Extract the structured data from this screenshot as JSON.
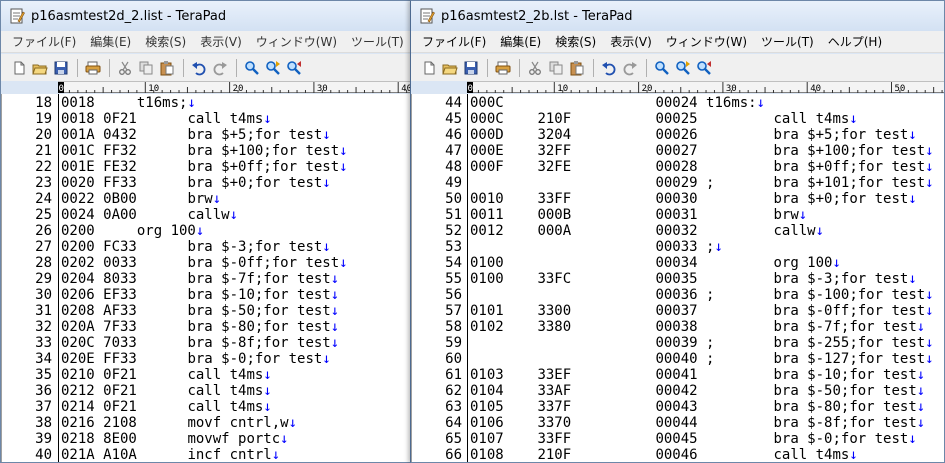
{
  "left_window": {
    "title": "p16asmtest2d_2.list - TeraPad",
    "menu": [
      "ファイル(F)",
      "編集(E)",
      "検索(S)",
      "表示(V)",
      "ウィンドウ(W)",
      "ツール(T)"
    ],
    "ruler_labels": [
      "0",
      "10",
      "20",
      "30",
      "40"
    ],
    "eol_mark": "↓",
    "lines": [
      {
        "n": "18",
        "addr": "0018",
        "code": "",
        "src": "t16ms;",
        "eol": true
      },
      {
        "n": "19",
        "addr": "0018",
        "code": "0F21",
        "src": "call t4ms",
        "eol": true
      },
      {
        "n": "20",
        "addr": "001A",
        "code": "0432",
        "src": "bra $+5;for test",
        "eol": true
      },
      {
        "n": "21",
        "addr": "001C",
        "code": "FF32",
        "src": "bra $+100;for test",
        "eol": true
      },
      {
        "n": "22",
        "addr": "001E",
        "code": "FE32",
        "src": "bra $+0ff;for test",
        "eol": true
      },
      {
        "n": "23",
        "addr": "0020",
        "code": "FF33",
        "src": "bra $+0;for test",
        "eol": true
      },
      {
        "n": "24",
        "addr": "0022",
        "code": "0B00",
        "src": "brw",
        "eol": true
      },
      {
        "n": "25",
        "addr": "0024",
        "code": "0A00",
        "src": "callw",
        "eol": true
      },
      {
        "n": "26",
        "addr": "0200",
        "code": "",
        "src": "org 100",
        "eol": true
      },
      {
        "n": "27",
        "addr": "0200",
        "code": "FC33",
        "src": "bra $-3;for test",
        "eol": true
      },
      {
        "n": "28",
        "addr": "0202",
        "code": "0033",
        "src": "bra $-0ff;for test",
        "eol": true
      },
      {
        "n": "29",
        "addr": "0204",
        "code": "8033",
        "src": "bra $-7f;for test",
        "eol": true
      },
      {
        "n": "30",
        "addr": "0206",
        "code": "EF33",
        "src": "bra $-10;for test",
        "eol": true
      },
      {
        "n": "31",
        "addr": "0208",
        "code": "AF33",
        "src": "bra $-50;for test",
        "eol": true
      },
      {
        "n": "32",
        "addr": "020A",
        "code": "7F33",
        "src": "bra $-80;for test",
        "eol": true
      },
      {
        "n": "33",
        "addr": "020C",
        "code": "7033",
        "src": "bra $-8f;for test",
        "eol": true
      },
      {
        "n": "34",
        "addr": "020E",
        "code": "FF33",
        "src": "bra $-0;for test",
        "eol": true
      },
      {
        "n": "35",
        "addr": "0210",
        "code": "0F21",
        "src": "call t4ms",
        "eol": true
      },
      {
        "n": "36",
        "addr": "0212",
        "code": "0F21",
        "src": "call t4ms",
        "eol": true
      },
      {
        "n": "37",
        "addr": "0214",
        "code": "0F21",
        "src": "call t4ms",
        "eol": true
      },
      {
        "n": "38",
        "addr": "0216",
        "code": "2108",
        "src": "movf cntrl,w",
        "eol": true
      },
      {
        "n": "39",
        "addr": "0218",
        "code": "8E00",
        "src": "movwf portc",
        "eol": true
      },
      {
        "n": "40",
        "addr": "021A",
        "code": "A10A",
        "src": "incf cntrl",
        "eol": true
      }
    ]
  },
  "right_window": {
    "title": "p16asmtest2_2b.lst - TeraPad",
    "menu": [
      "ファイル(F)",
      "編集(E)",
      "検索(S)",
      "表示(V)",
      "ウィンドウ(W)",
      "ツール(T)",
      "ヘルプ(H)"
    ],
    "ruler_labels": [
      "0",
      "10",
      "20",
      "30",
      "40",
      "50"
    ],
    "eol_mark": "↓",
    "lines": [
      {
        "n": "44",
        "addr": "000C",
        "code": "",
        "seq": "00024",
        "src": "t16ms:",
        "indent": false,
        "eol": true
      },
      {
        "n": "45",
        "addr": "000C",
        "code": "210F",
        "seq": "00025",
        "src": "call t4ms",
        "indent": true,
        "eol": true
      },
      {
        "n": "46",
        "addr": "000D",
        "code": "3204",
        "seq": "00026",
        "src": "bra $+5;for test",
        "indent": true,
        "eol": true
      },
      {
        "n": "47",
        "addr": "000E",
        "code": "32FF",
        "seq": "00027",
        "src": "bra $+100;for test",
        "indent": true,
        "eol": true
      },
      {
        "n": "48",
        "addr": "000F",
        "code": "32FE",
        "seq": "00028",
        "src": "bra $+0ff;for test",
        "indent": true,
        "eol": true
      },
      {
        "n": "49",
        "addr": "",
        "code": "",
        "seq": "00029 ;",
        "src": "bra $+101;for test",
        "indent": true,
        "eol": true
      },
      {
        "n": "50",
        "addr": "0010",
        "code": "33FF",
        "seq": "00030",
        "src": "bra $+0;for test",
        "indent": true,
        "eol": true
      },
      {
        "n": "51",
        "addr": "0011",
        "code": "000B",
        "seq": "00031",
        "src": "brw",
        "indent": true,
        "eol": true
      },
      {
        "n": "52",
        "addr": "0012",
        "code": "000A",
        "seq": "00032",
        "src": "callw",
        "indent": true,
        "eol": true
      },
      {
        "n": "53",
        "addr": "",
        "code": "",
        "seq": "00033 ;",
        "src": "",
        "indent": false,
        "eol": true
      },
      {
        "n": "54",
        "addr": "0100",
        "code": "",
        "seq": "00034",
        "src": "org 100",
        "indent": true,
        "eol": true
      },
      {
        "n": "55",
        "addr": "0100",
        "code": "33FC",
        "seq": "00035",
        "src": "bra $-3;for test",
        "indent": true,
        "eol": true
      },
      {
        "n": "56",
        "addr": "",
        "code": "",
        "seq": "00036 ;",
        "src": "bra $-100;for test",
        "indent": true,
        "eol": true
      },
      {
        "n": "57",
        "addr": "0101",
        "code": "3300",
        "seq": "00037",
        "src": "bra $-0ff;for test",
        "indent": true,
        "eol": true
      },
      {
        "n": "58",
        "addr": "0102",
        "code": "3380",
        "seq": "00038",
        "src": "bra $-7f;for test",
        "indent": true,
        "eol": true
      },
      {
        "n": "59",
        "addr": "",
        "code": "",
        "seq": "00039 ;",
        "src": "bra $-255;for test",
        "indent": true,
        "eol": true
      },
      {
        "n": "60",
        "addr": "",
        "code": "",
        "seq": "00040 ;",
        "src": "bra $-127;for test",
        "indent": true,
        "eol": true
      },
      {
        "n": "61",
        "addr": "0103",
        "code": "33EF",
        "seq": "00041",
        "src": "bra $-10;for test",
        "indent": true,
        "eol": true
      },
      {
        "n": "62",
        "addr": "0104",
        "code": "33AF",
        "seq": "00042",
        "src": "bra $-50;for test",
        "indent": true,
        "eol": true
      },
      {
        "n": "63",
        "addr": "0105",
        "code": "337F",
        "seq": "00043",
        "src": "bra $-80;for test",
        "indent": true,
        "eol": true
      },
      {
        "n": "64",
        "addr": "0106",
        "code": "3370",
        "seq": "00044",
        "src": "bra $-8f;for test",
        "indent": true,
        "eol": true
      },
      {
        "n": "65",
        "addr": "0107",
        "code": "33FF",
        "seq": "00045",
        "src": "bra $-0;for test",
        "indent": true,
        "eol": true
      },
      {
        "n": "66",
        "addr": "0108",
        "code": "210F",
        "seq": "00046",
        "src": "call t4ms",
        "indent": true,
        "eol": true
      }
    ]
  },
  "toolbar_icons": [
    "new-file-icon",
    "open-folder-icon",
    "save-icon",
    "print-icon",
    "cut-icon",
    "copy-icon",
    "paste-icon",
    "undo-icon",
    "redo-icon",
    "find-icon",
    "find-next-icon",
    "find-prev-icon"
  ]
}
